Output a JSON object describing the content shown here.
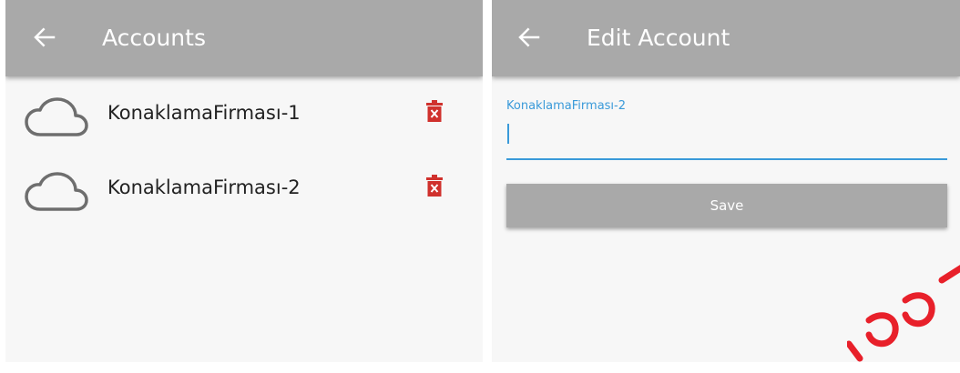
{
  "accounts_screen": {
    "title": "Accounts",
    "back_icon": "arrow-left-icon",
    "items": [
      {
        "name": "KonaklamaFirması-1",
        "icon": "cloud-icon",
        "action_icon": "trash-icon"
      },
      {
        "name": "KonaklamaFirması-2",
        "icon": "cloud-icon",
        "action_icon": "trash-icon"
      }
    ]
  },
  "edit_screen": {
    "title": "Edit Account",
    "back_icon": "arrow-left-icon",
    "field_label": "KonaklamaFirması-2",
    "field_value": "",
    "save_label": "Save"
  },
  "colors": {
    "appbar": "#a9a9a9",
    "background": "#f7f7f7",
    "accent": "#3a9ad9",
    "delete": "#d0312d",
    "icon_gray": "#6e6e6e"
  }
}
